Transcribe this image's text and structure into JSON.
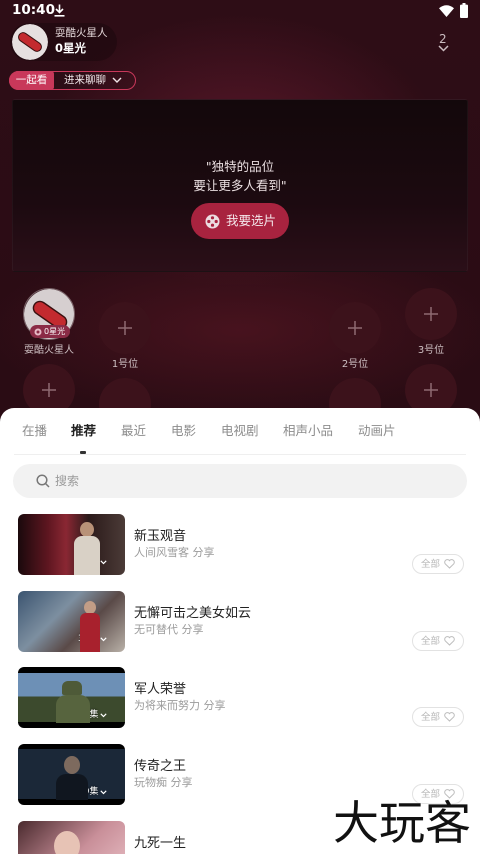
{
  "status_bar": {
    "time": "10:40"
  },
  "header": {
    "user_name": "耍酷火星人",
    "stars": "0星光",
    "online_count": "2"
  },
  "room_mode": {
    "active_label": "一起看",
    "chat_label": "进来聊聊"
  },
  "player": {
    "slogan_line1": "\"独特的品位",
    "slogan_line2": "要让更多人看到\"",
    "pick_button": "我要选片"
  },
  "seats": [
    {
      "name": "耍酷火星人",
      "badge": "0星光"
    },
    {
      "label": "1号位"
    },
    {
      "label": "2号位"
    },
    {
      "label": "3号位"
    }
  ],
  "sheet": {
    "tabs": [
      "在播",
      "推荐",
      "最近",
      "电影",
      "电视剧",
      "相声小品",
      "动画片"
    ],
    "active_tab_index": 1,
    "search_placeholder": "搜索",
    "items": [
      {
        "title": "新玉观音",
        "subtitle": "人间风雪客 分享",
        "episodes": "28集",
        "action": "全部"
      },
      {
        "title": "无懈可击之美女如云",
        "subtitle": "无可替代 分享",
        "episodes": "36集",
        "action": "全部"
      },
      {
        "title": "军人荣誉",
        "subtitle": "为将来而努力 分享",
        "episodes": "26集",
        "action": "全部"
      },
      {
        "title": "传奇之王",
        "subtitle": "玩物痴 分享",
        "episodes": "39集",
        "action": "全部"
      },
      {
        "title": "九死一生"
      }
    ]
  },
  "colors": {
    "accent": "#c8385a",
    "pick_button": "#a8233f"
  },
  "watermark": "大玩客"
}
